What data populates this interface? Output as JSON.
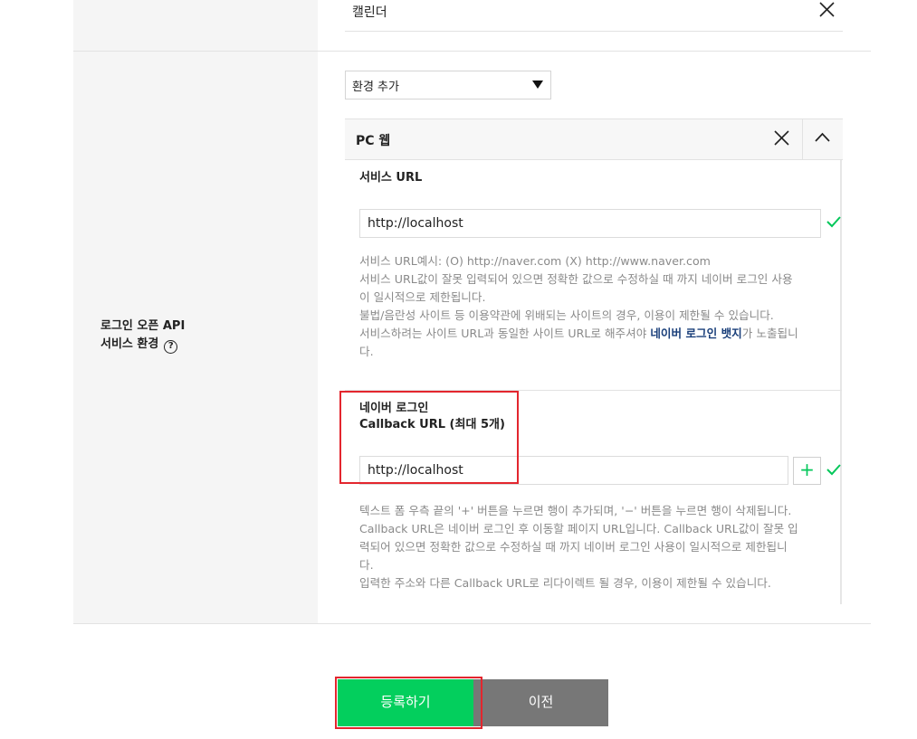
{
  "app_row": {
    "item_label": "캘린더"
  },
  "service_env": {
    "section_label_line1": "로그인 오픈 API",
    "section_label_line2": "서비스 환경",
    "help_icon": "?",
    "add_env_select": "환경 추가",
    "env_title": "PC 웹",
    "service_url": {
      "title": "서비스 URL",
      "value": "http://localhost",
      "desc_lines": [
        "서비스 URL예시: (O) http://naver.com (X) http://www.naver.com",
        "서비스 URL값이 잘못 입력되어 있으면 정확한 값으로 수정하실 때 까지 네이버 로그인 사용",
        "이 일시적으로 제한됩니다.",
        "불법/음란성 사이트 등 이용약관에 위배되는 사이트의 경우, 이용이 제한될 수 있습니다."
      ],
      "desc_last_prefix": "서비스하려는 사이트 URL과 동일한 사이트 URL로 해주셔야 ",
      "desc_last_bold": "네이버 로그인 뱃지",
      "desc_last_suffix": "가 노출됩니",
      "desc_last_wrap": "다."
    },
    "callback": {
      "title_line1": "네이버 로그인",
      "title_line2": "Callback URL (최대 5개)",
      "value": "http://localhost",
      "plus_label": "+",
      "desc_lines": [
        "텍스트 폼 우측 끝의 '+' 버튼을 누르면 행이 추가되며, '−' 버튼을 누르면 행이 삭제됩니다.",
        "Callback URL은 네이버 로그인 후 이동할 페이지 URL입니다. Callback URL값이 잘못 입",
        "력되어 있으면 정확한 값으로 수정하실 때 까지 네이버 로그인 사용이 일시적으로 제한됩니",
        "다.",
        "입력한 주소와 다른 Callback URL로 리다이렉트 될 경우, 이용이 제한될 수 있습니다."
      ]
    }
  },
  "buttons": {
    "register": "등록하기",
    "previous": "이전"
  },
  "colors": {
    "primary": "#03cf5d",
    "secondary": "#777777",
    "highlight": "#e3262e",
    "link": "#1a3f7a"
  }
}
